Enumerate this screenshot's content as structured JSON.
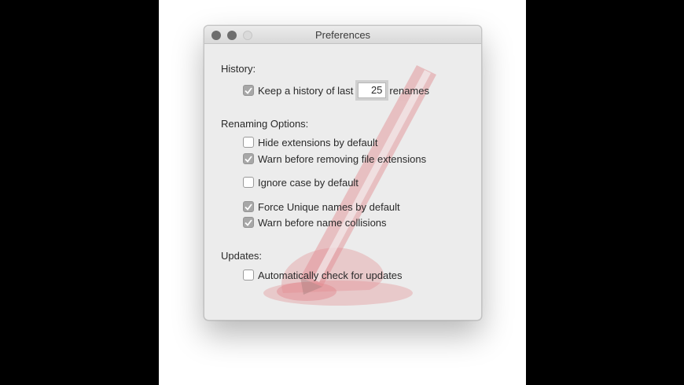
{
  "window": {
    "title": "Preferences"
  },
  "history": {
    "heading": "History:",
    "keep": {
      "label_before": "Keep a history of last",
      "value": "25",
      "label_after": "renames",
      "checked": true
    }
  },
  "renaming": {
    "heading": "Renaming Options:",
    "options": [
      {
        "label": "Hide extensions by default",
        "checked": false
      },
      {
        "label": "Warn before removing file extensions",
        "checked": true
      },
      {
        "label": "Ignore case by default",
        "checked": false
      },
      {
        "label": "Force Unique names by default",
        "checked": true
      },
      {
        "label": "Warn before name collisions",
        "checked": true
      }
    ]
  },
  "updates": {
    "heading": "Updates:",
    "auto_check": {
      "label": "Automatically check for updates",
      "checked": false
    }
  },
  "colors": {
    "watermark_red": "#d9363e",
    "checkbox_checked": "#a7a7a7"
  }
}
